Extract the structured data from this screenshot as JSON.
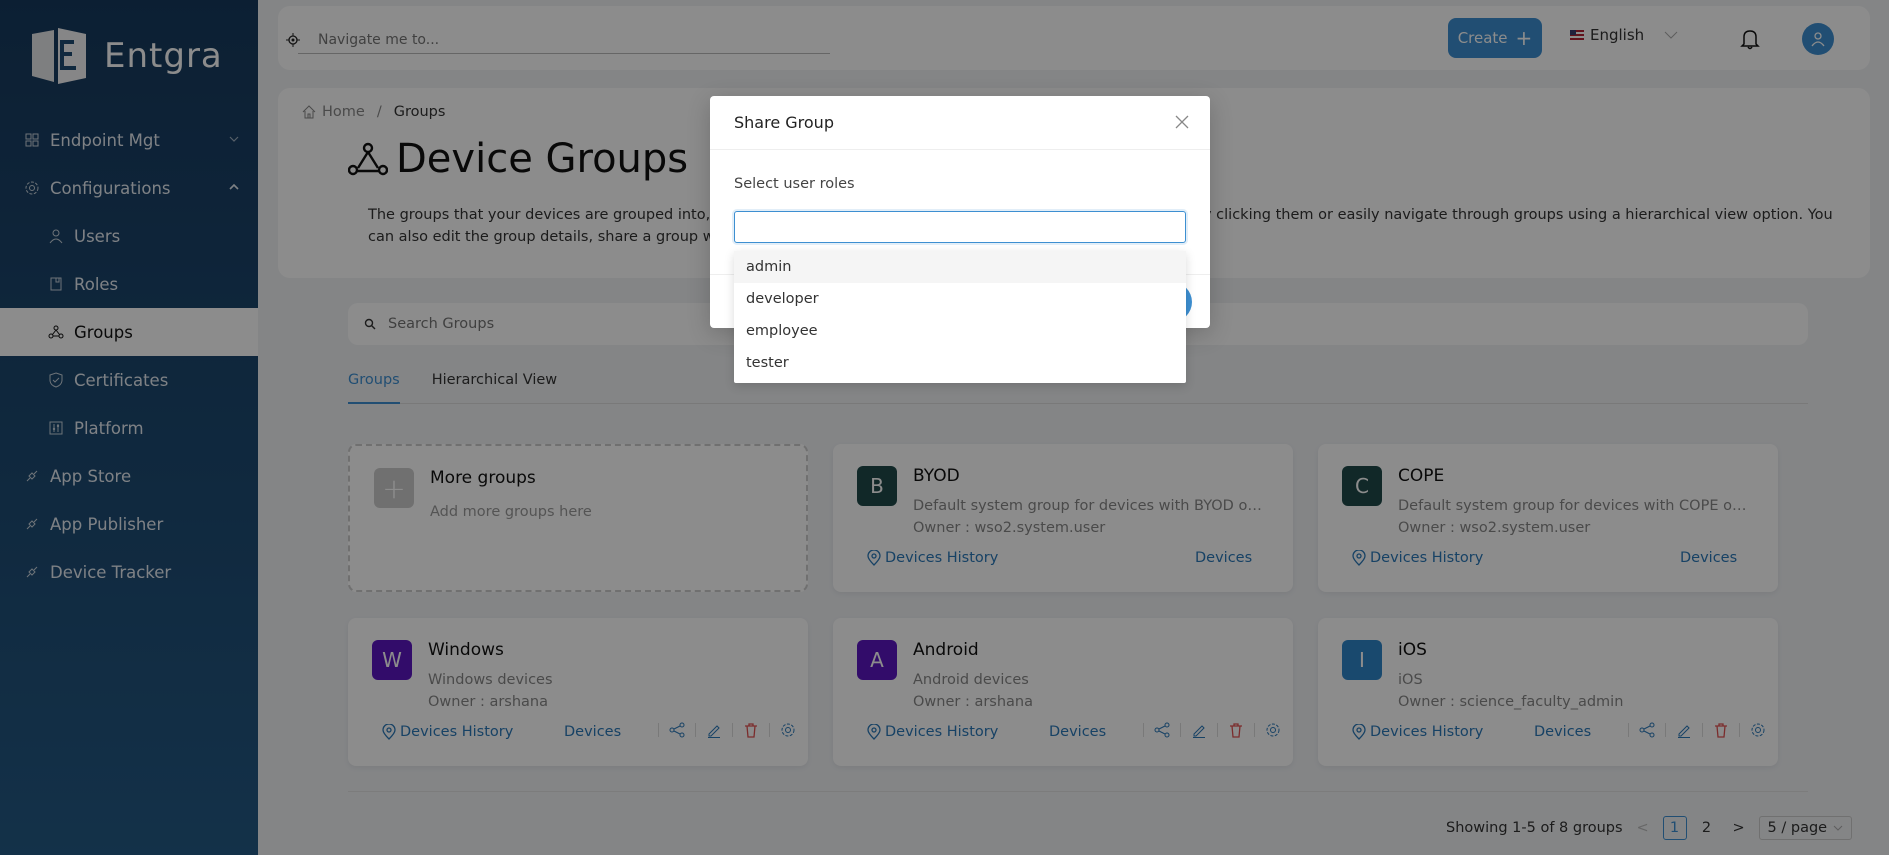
{
  "brand": {
    "name": "Entgra"
  },
  "sidebar": {
    "items": [
      {
        "label": "Endpoint Mgt",
        "icon": "grid-icon",
        "expandable": true,
        "expanded": false
      },
      {
        "label": "Configurations",
        "icon": "gear-icon",
        "expandable": true,
        "expanded": true
      },
      {
        "label": "Users",
        "icon": "user-icon",
        "sub": true
      },
      {
        "label": "Roles",
        "icon": "book-icon",
        "sub": true
      },
      {
        "label": "Groups",
        "icon": "groups-icon",
        "sub": true,
        "active": true
      },
      {
        "label": "Certificates",
        "icon": "shield-check-icon",
        "sub": true
      },
      {
        "label": "Platform",
        "icon": "sliders-icon",
        "sub": true
      },
      {
        "label": "App Store",
        "icon": "link-icon"
      },
      {
        "label": "App Publisher",
        "icon": "link-icon"
      },
      {
        "label": "Device Tracker",
        "icon": "link-icon"
      }
    ]
  },
  "topbar": {
    "navigate_placeholder": "Navigate me to...",
    "create_label": "Create",
    "language": "English"
  },
  "breadcrumb": {
    "home": "Home",
    "current": "Groups"
  },
  "page": {
    "title": "Device Groups",
    "description": "The groups that your devices are grouped into, are displayed here. You can view the devices of a specified group by clicking them or easily navigate through groups using a hierarchical view option. You can also edit the group details, share a group with specific user roles, or delete a group under Actions."
  },
  "search": {
    "placeholder": "Search Groups"
  },
  "tabs": [
    {
      "label": "Groups",
      "active": true
    },
    {
      "label": "Hierarchical View",
      "active": false
    }
  ],
  "more_groups": {
    "title": "More groups",
    "subtitle": "Add more groups here"
  },
  "groups": [
    {
      "initial": "B",
      "name": "BYOD",
      "description": "Default system group for devices with BYOD owne...",
      "owner": "Owner : wso2.system.user",
      "history": "Devices History",
      "devices": "Devices",
      "color": "#1f4a4a",
      "actions": false
    },
    {
      "initial": "C",
      "name": "COPE",
      "description": "Default system group for devices with COPE owne...",
      "owner": "Owner : wso2.system.user",
      "history": "Devices History",
      "devices": "Devices",
      "color": "#1f4a4a",
      "actions": false
    },
    {
      "initial": "W",
      "name": "Windows",
      "description": "Windows devices",
      "owner": "Owner : arshana",
      "history": "Devices History",
      "devices": "Devices",
      "color": "#5b16c2",
      "actions": true
    },
    {
      "initial": "A",
      "name": "Android",
      "description": "Android devices",
      "owner": "Owner : arshana",
      "history": "Devices History",
      "devices": "Devices",
      "color": "#5b16c2",
      "actions": true
    },
    {
      "initial": "I",
      "name": "iOS",
      "description": "iOS",
      "owner": "Owner : science_faculty_admin",
      "history": "Devices History",
      "devices": "Devices",
      "color": "#2f86c9",
      "actions": true
    }
  ],
  "pagination": {
    "summary": "Showing 1-5 of 8 groups",
    "pages": [
      "1",
      "2"
    ],
    "current": "1",
    "page_size": "5 / page"
  },
  "modal": {
    "title": "Share Group",
    "label": "Select user roles",
    "input_value": "",
    "options": [
      "admin",
      "developer",
      "employee",
      "tester"
    ],
    "highlighted": "admin"
  },
  "colors": {
    "accent": "#3d8fd1",
    "sidebar": "#173a5e",
    "danger": "#e05050"
  }
}
